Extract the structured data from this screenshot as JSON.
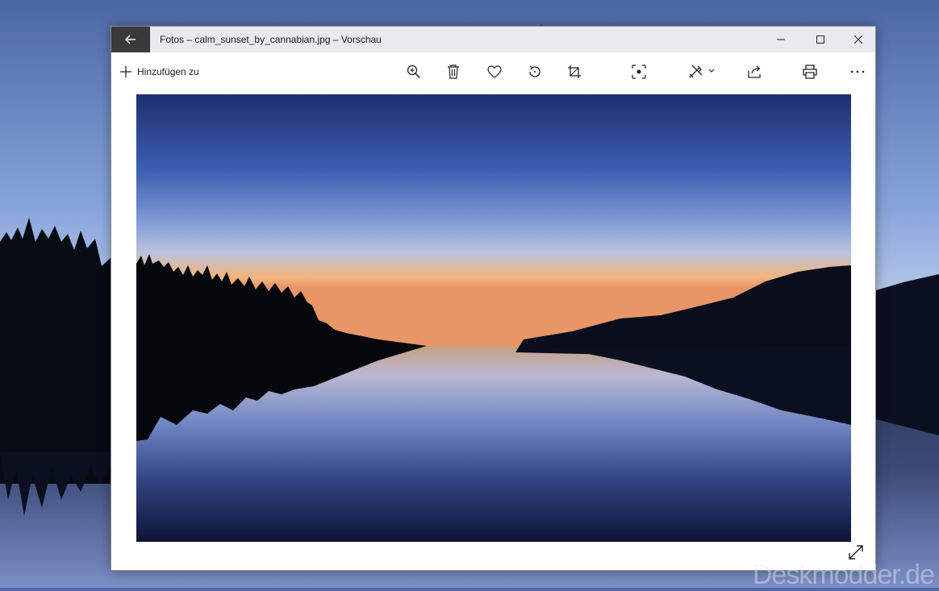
{
  "window": {
    "title": "Fotos – calm_sunset_by_cannabian.jpg – Vorschau"
  },
  "toolbar": {
    "add_to_label": "Hinzufügen zu",
    "buttons": [
      {
        "icon": "zoom-in-icon"
      },
      {
        "icon": "delete-icon"
      },
      {
        "icon": "favorite-heart-icon"
      },
      {
        "icon": "rotate-icon"
      },
      {
        "icon": "crop-icon"
      },
      {
        "icon": "focus-icon"
      },
      {
        "icon": "edit-draw-icon"
      },
      {
        "icon": "share-icon"
      },
      {
        "icon": "print-icon"
      },
      {
        "icon": "more-icon"
      }
    ]
  },
  "watermark": {
    "text": "Deskmodder.de"
  },
  "colors": {
    "titlebar_bg": "#e8eaee",
    "back_button_bg": "#3a3a3a",
    "annotation_arrow": "#111111"
  }
}
